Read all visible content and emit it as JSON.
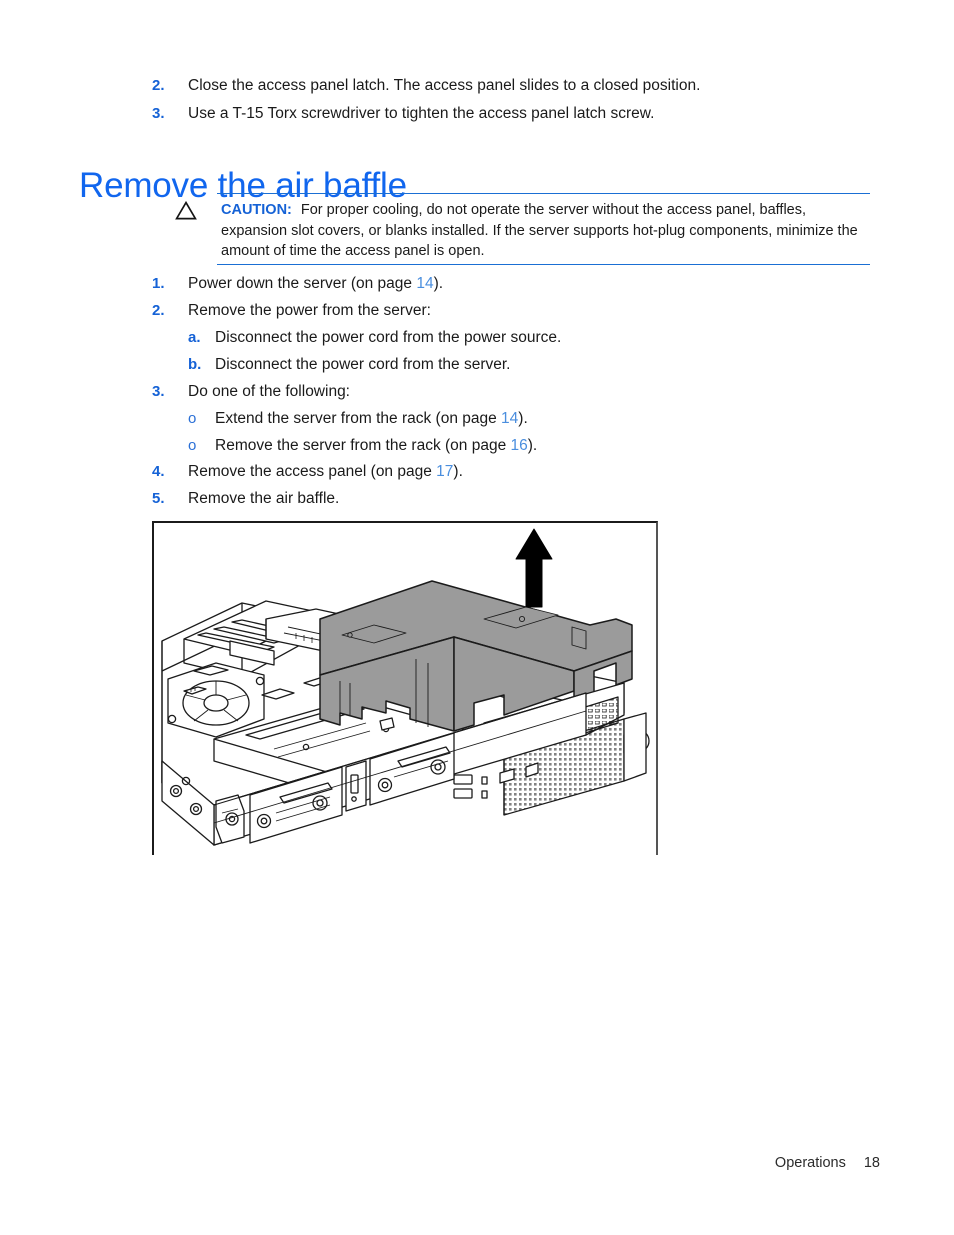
{
  "document": {
    "type": "hardware-maintenance-guide-page",
    "page_number": "18",
    "footer_section": "Operations"
  },
  "top_steps": [
    {
      "marker": "2.",
      "text": "Close the access panel latch. The access panel slides to a closed position."
    },
    {
      "marker": "3.",
      "text": "Use a T-15 Torx screwdriver to tighten the access panel latch screw."
    }
  ],
  "heading": {
    "title": "Remove the air baffle",
    "color": "#1166ee"
  },
  "caution": {
    "icon": "warning-triangle-icon",
    "label": "CAUTION:",
    "label_color": "#1562d6",
    "rule_color": "#1a6fd4",
    "text": "For proper cooling, do not operate the server without the access panel, baffles, expansion slot covers, or blanks installed. If the server supports hot-plug components, minimize the amount of time the access panel is open."
  },
  "procedure": [
    {
      "marker": "1.",
      "kind": "number",
      "pre": "Power down the server (on page ",
      "ref": "14",
      "post": ")."
    },
    {
      "marker": "2.",
      "kind": "number",
      "pre": "Remove the power from the server:",
      "ref": "",
      "post": ""
    },
    {
      "marker": "a.",
      "kind": "alpha",
      "pre": "Disconnect the power cord from the power source.",
      "ref": "",
      "post": ""
    },
    {
      "marker": "b.",
      "kind": "alpha",
      "pre": "Disconnect the power cord from the server.",
      "ref": "",
      "post": ""
    },
    {
      "marker": "3.",
      "kind": "number",
      "pre": "Do one of the following:",
      "ref": "",
      "post": ""
    },
    {
      "marker": "o",
      "kind": "bullet",
      "pre": "Extend the server from the rack (on page ",
      "ref": "14",
      "post": ")."
    },
    {
      "marker": "o",
      "kind": "bullet",
      "pre": "Remove the server from the rack (on page ",
      "ref": "16",
      "post": ")."
    },
    {
      "marker": "4.",
      "kind": "number",
      "pre": "Remove the access panel (on page ",
      "ref": "17",
      "post": ")."
    },
    {
      "marker": "5.",
      "kind": "number",
      "pre": "Remove the air baffle.",
      "ref": "",
      "post": ""
    }
  ],
  "figure": {
    "name": "air-baffle-removal-illustration",
    "description": "Line drawing of a 1U rack server chassis with the access panel removed; the gray air baffle is lifted straight up out of the chassis, indicated by a large upward arrow.",
    "baffle_color": "#9b9b9b",
    "line_color": "#1b1b1b",
    "arrow_direction": "up"
  },
  "footer": {
    "section": "Operations",
    "page": "18"
  }
}
